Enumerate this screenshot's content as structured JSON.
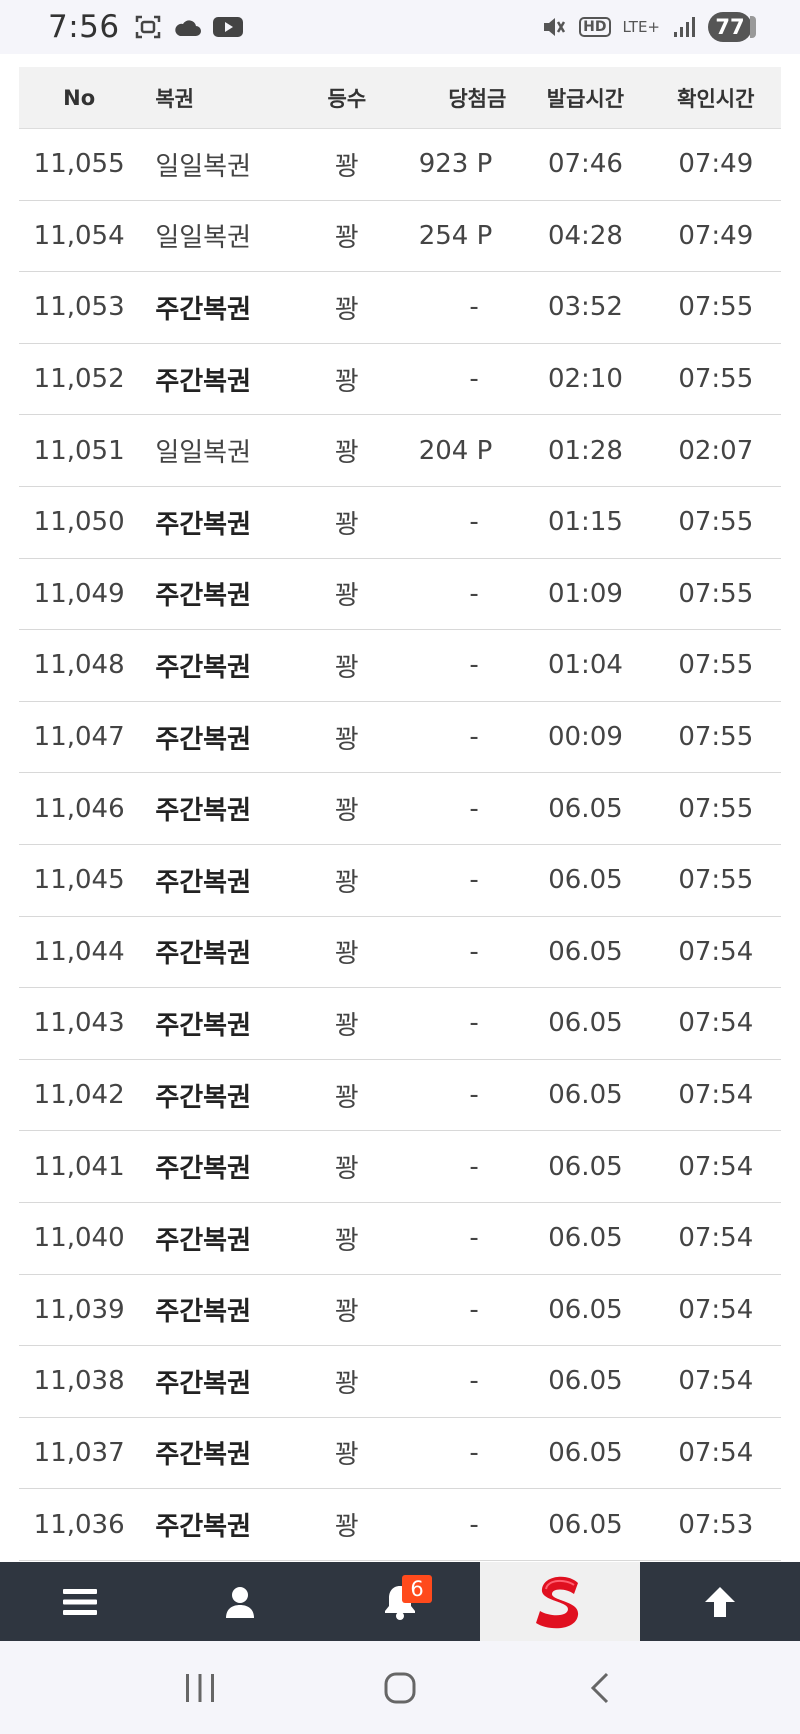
{
  "status_bar": {
    "time": "7:56",
    "network": "LTE+",
    "hd": "HD",
    "battery": "77"
  },
  "table": {
    "headers": {
      "no": "No",
      "name": "복권",
      "rank": "등수",
      "prize": "당첨금",
      "issued": "발급시간",
      "checked": "확인시간"
    },
    "rows": [
      {
        "no": "11,055",
        "name": "일일복권",
        "rank": "꽝",
        "prize": "923 P",
        "issued": "07:46",
        "checked": "07:49"
      },
      {
        "no": "11,054",
        "name": "일일복권",
        "rank": "꽝",
        "prize": "254 P",
        "issued": "04:28",
        "checked": "07:49"
      },
      {
        "no": "11,053",
        "name": "주간복권",
        "rank": "꽝",
        "prize": "-",
        "issued": "03:52",
        "checked": "07:55"
      },
      {
        "no": "11,052",
        "name": "주간복권",
        "rank": "꽝",
        "prize": "-",
        "issued": "02:10",
        "checked": "07:55"
      },
      {
        "no": "11,051",
        "name": "일일복권",
        "rank": "꽝",
        "prize": "204 P",
        "issued": "01:28",
        "checked": "02:07"
      },
      {
        "no": "11,050",
        "name": "주간복권",
        "rank": "꽝",
        "prize": "-",
        "issued": "01:15",
        "checked": "07:55"
      },
      {
        "no": "11,049",
        "name": "주간복권",
        "rank": "꽝",
        "prize": "-",
        "issued": "01:09",
        "checked": "07:55"
      },
      {
        "no": "11,048",
        "name": "주간복권",
        "rank": "꽝",
        "prize": "-",
        "issued": "01:04",
        "checked": "07:55"
      },
      {
        "no": "11,047",
        "name": "주간복권",
        "rank": "꽝",
        "prize": "-",
        "issued": "00:09",
        "checked": "07:55"
      },
      {
        "no": "11,046",
        "name": "주간복권",
        "rank": "꽝",
        "prize": "-",
        "issued": "06.05",
        "checked": "07:55"
      },
      {
        "no": "11,045",
        "name": "주간복권",
        "rank": "꽝",
        "prize": "-",
        "issued": "06.05",
        "checked": "07:55"
      },
      {
        "no": "11,044",
        "name": "주간복권",
        "rank": "꽝",
        "prize": "-",
        "issued": "06.05",
        "checked": "07:54"
      },
      {
        "no": "11,043",
        "name": "주간복권",
        "rank": "꽝",
        "prize": "-",
        "issued": "06.05",
        "checked": "07:54"
      },
      {
        "no": "11,042",
        "name": "주간복권",
        "rank": "꽝",
        "prize": "-",
        "issued": "06.05",
        "checked": "07:54"
      },
      {
        "no": "11,041",
        "name": "주간복권",
        "rank": "꽝",
        "prize": "-",
        "issued": "06.05",
        "checked": "07:54"
      },
      {
        "no": "11,040",
        "name": "주간복권",
        "rank": "꽝",
        "prize": "-",
        "issued": "06.05",
        "checked": "07:54"
      },
      {
        "no": "11,039",
        "name": "주간복권",
        "rank": "꽝",
        "prize": "-",
        "issued": "06.05",
        "checked": "07:54"
      },
      {
        "no": "11,038",
        "name": "주간복권",
        "rank": "꽝",
        "prize": "-",
        "issued": "06.05",
        "checked": "07:54"
      },
      {
        "no": "11,037",
        "name": "주간복권",
        "rank": "꽝",
        "prize": "-",
        "issued": "06.05",
        "checked": "07:54"
      },
      {
        "no": "11,036",
        "name": "주간복권",
        "rank": "꽝",
        "prize": "-",
        "issued": "06.05",
        "checked": "07:53"
      }
    ]
  },
  "toolbar": {
    "items": [
      "menu-icon",
      "user-icon",
      "bell-icon",
      "site-logo",
      "arrow-up-icon"
    ],
    "notification_count": "6",
    "colors": {
      "background": "#2f3640",
      "badge": "#ff4a1c",
      "logo_red": "#e01020"
    }
  },
  "navbar": {
    "items": [
      "recent-apps-icon",
      "home-icon",
      "back-icon"
    ]
  }
}
